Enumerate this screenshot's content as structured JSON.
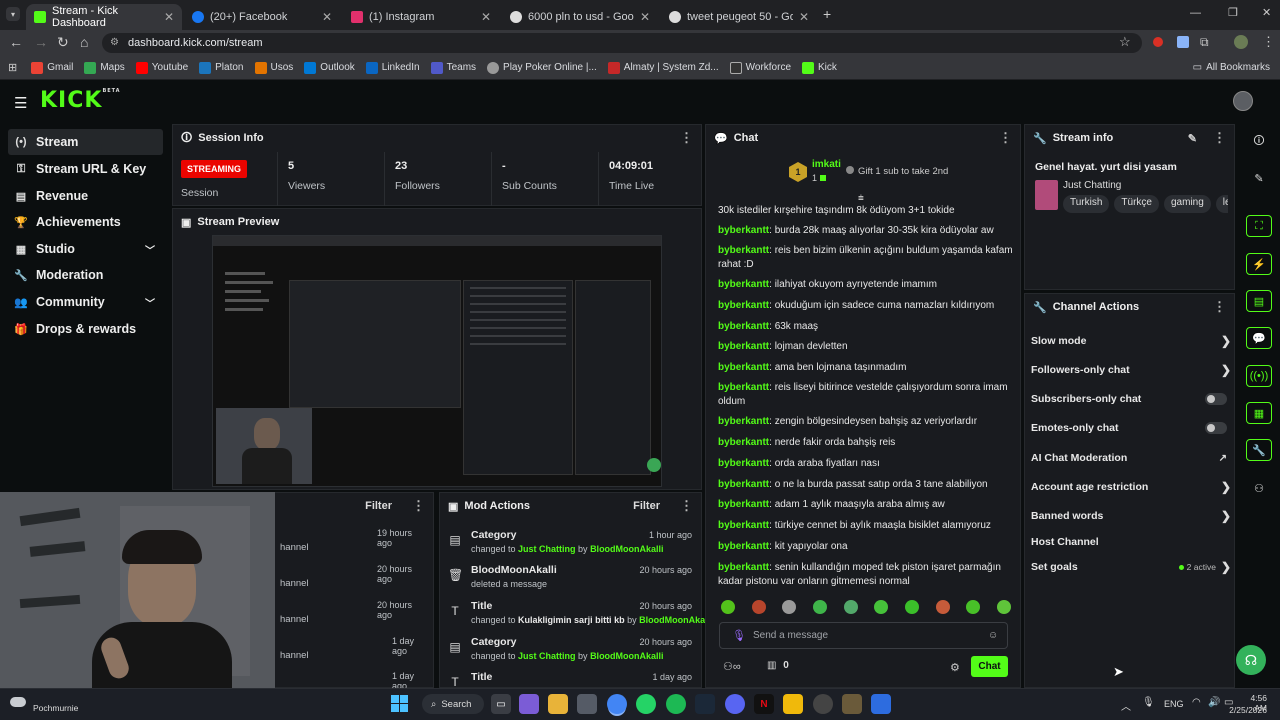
{
  "browser": {
    "tabs": [
      {
        "title": "Stream - Kick Dashboard",
        "icon": "kick-icon"
      },
      {
        "title": "(20+) Facebook",
        "icon": "facebook-icon"
      },
      {
        "title": "(1) Instagram",
        "icon": "instagram-icon"
      },
      {
        "title": "6000 pln to usd - Google Search",
        "icon": "google-icon"
      },
      {
        "title": "tweet peugeot 50 - Google Search",
        "icon": "google-icon"
      }
    ],
    "url": "dashboard.kick.com/stream",
    "bookmarks": [
      "Gmail",
      "Maps",
      "Youtube",
      "Platon",
      "Usos",
      "Outlook",
      "LinkedIn",
      "Teams",
      "Play Poker Online |...",
      "Almaty | System Zd...",
      "Workforce",
      "Kick"
    ],
    "all_bookmarks": "All Bookmarks"
  },
  "kick": {
    "logo": "KICK",
    "logo_sup": "BETA"
  },
  "sidebar": {
    "items": [
      {
        "label": "Stream",
        "icon": "stream-icon"
      },
      {
        "label": "Stream URL & Key",
        "icon": "key-icon"
      },
      {
        "label": "Revenue",
        "icon": "revenue-icon"
      },
      {
        "label": "Achievements",
        "icon": "trophy-icon"
      },
      {
        "label": "Studio",
        "icon": "studio-icon"
      },
      {
        "label": "Moderation",
        "icon": "wrench-icon"
      },
      {
        "label": "Community",
        "icon": "community-icon"
      },
      {
        "label": "Drops & rewards",
        "icon": "gift-icon"
      }
    ]
  },
  "session": {
    "title": "Session Info",
    "badge": "STREAMING",
    "session_label": "Session",
    "viewers": "5",
    "viewers_label": "Viewers",
    "followers": "23",
    "followers_label": "Followers",
    "subs": "-",
    "subs_label": "Sub Counts",
    "time": "04:09:01",
    "time_label": "Time Live"
  },
  "preview": {
    "title": "Stream Preview"
  },
  "activity": {
    "filter": "Filter",
    "rows": [
      {
        "text": "hannel",
        "time": "19 hours ago"
      },
      {
        "text": "hannel",
        "time": "20 hours ago"
      },
      {
        "text": "hannel",
        "time": "20 hours ago"
      },
      {
        "text": "hannel",
        "time": "1 day ago"
      },
      {
        "text": "",
        "time": "1 day ago"
      }
    ]
  },
  "mod_actions": {
    "title": "Mod Actions",
    "filter": "Filter",
    "rows": [
      {
        "title": "Category",
        "pre": "changed to ",
        "target": "Just Chatting",
        "mid": " by ",
        "user": "BloodMoonAkalli",
        "time": "1 hour ago",
        "icon": "category-icon"
      },
      {
        "title": "BloodMoonAkalli",
        "pre": "deleted a message",
        "target": "",
        "mid": "",
        "user": "",
        "time": "20 hours ago",
        "icon": "trash-icon"
      },
      {
        "title": "Title",
        "pre": "changed to ",
        "target": "Kulakligimin sarji bitti kb",
        "mid": " by ",
        "user": "BloodMoonAkalli",
        "time": "20 hours ago",
        "icon": "title-icon"
      },
      {
        "title": "Category",
        "pre": "changed to ",
        "target": "Just Chatting",
        "mid": " by ",
        "user": "BloodMoonAkalli",
        "time": "20 hours ago",
        "icon": "category-icon"
      },
      {
        "title": "Title",
        "pre": "",
        "target": "",
        "mid": "",
        "user": "",
        "time": "1 day ago",
        "icon": "title-icon"
      }
    ]
  },
  "chat": {
    "title": "Chat",
    "pinned_user": "imkati",
    "pinned_rank": "1",
    "pinned_count": "1",
    "gift_text": "Gift 1 sub to take 2nd",
    "messages": [
      {
        "user": "",
        "text": "30k istediler kırşehire taşındım 8k ödüyom 3+1 tokide"
      },
      {
        "user": "byberkantt",
        "text": "burda 28k maaş alıyorlar 30-35k kira ödüyolar aw"
      },
      {
        "user": "byberkantt",
        "text": "reis ben bizim ülkenin açığını buldum yaşamda kafam rahat :D"
      },
      {
        "user": "byberkantt",
        "text": "ilahiyat okuyom ayrıyetende imamım"
      },
      {
        "user": "byberkantt",
        "text": "okuduğum için sadece cuma namazları kıldırıyom"
      },
      {
        "user": "byberkantt",
        "text": "63k maaş"
      },
      {
        "user": "byberkantt",
        "text": "lojman devletten"
      },
      {
        "user": "byberkantt",
        "text": "ama ben lojmana taşınmadım"
      },
      {
        "user": "byberkantt",
        "text": "reis liseyi bitirince vestelde çalışıyordum sonra imam oldum"
      },
      {
        "user": "byberkantt",
        "text": "zengin bölgesindeysen bahşiş az veriyorlardır"
      },
      {
        "user": "byberkantt",
        "text": "nerde fakir orda bahşiş reis"
      },
      {
        "user": "byberkantt",
        "text": "orda araba fiyatları nası"
      },
      {
        "user": "byberkantt",
        "text": "o ne la burda passat satıp orda 3 tane alabiliyon"
      },
      {
        "user": "byberkantt",
        "text": "adam 1 aylık maaşıyla araba almış aw"
      },
      {
        "user": "byberkantt",
        "text": "türkiye cennet bi aylık maaşla bisiklet alamıyoruz"
      },
      {
        "user": "byberkantt",
        "text": "kit yapıyolar ona"
      },
      {
        "user": "byberkantt",
        "text": "senin kullandığın moped tek piston işaret parmağın kadar pistonu var onların gitmemesi normal"
      }
    ],
    "placeholder": "Send a message",
    "points": "0",
    "send": "Chat"
  },
  "stream_info": {
    "title": "Stream info",
    "stream_title": "Genel hayat. yurt disi yasam",
    "category": "Just Chatting",
    "tags": [
      "Turkish",
      "Türkçe",
      "gaming",
      "lea"
    ]
  },
  "channel_actions": {
    "title": "Channel Actions",
    "items": [
      {
        "label": "Slow mode",
        "control": "chevron"
      },
      {
        "label": "Followers-only chat",
        "control": "chevron"
      },
      {
        "label": "Subscribers-only chat",
        "control": "toggle"
      },
      {
        "label": "Emotes-only chat",
        "control": "toggle"
      },
      {
        "label": "AI Chat Moderation",
        "control": "external"
      },
      {
        "label": "Account age restriction",
        "control": "chevron"
      },
      {
        "label": "Banned words",
        "control": "chevron"
      },
      {
        "label": "Host Channel",
        "control": "none"
      },
      {
        "label": "Set goals",
        "control": "chevron"
      }
    ],
    "goals_active": "2 active"
  },
  "taskbar": {
    "search": "Search",
    "lang": "ENG",
    "time": "4:56 AM",
    "date": "2/25/2026",
    "weather": "Pochmurnie"
  },
  "colors": {
    "accent": "#53fc18",
    "live": "#eb0400"
  }
}
